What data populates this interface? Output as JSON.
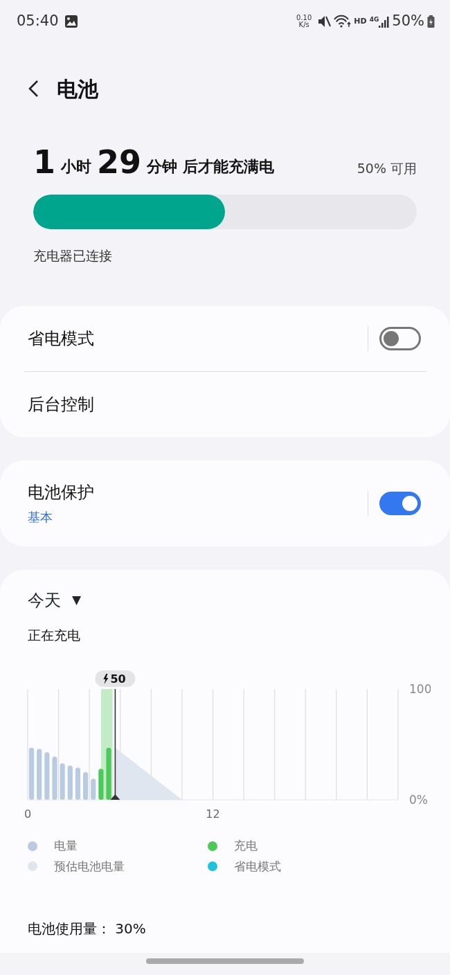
{
  "status_bar": {
    "time": "05:40",
    "net_speed": [
      "0.10",
      "K/s"
    ],
    "network": "HD",
    "cell": "4G",
    "battery": "50%"
  },
  "header": {
    "title": "电池"
  },
  "charge": {
    "parts": [
      {
        "kind": "number",
        "text": "1"
      },
      {
        "kind": "unit",
        "text": "小时"
      },
      {
        "kind": "number",
        "text": "29"
      },
      {
        "kind": "unit",
        "text": "分钟"
      },
      {
        "kind": "unit",
        "text": "后才能充满电"
      }
    ],
    "available": "50% 可用",
    "level": 0.5,
    "status": "充电器已连接"
  },
  "cards": [
    {
      "rows": [
        {
          "label": "省电模式",
          "kind": "toggle",
          "on": false
        },
        {
          "label": "后台控制",
          "kind": "link"
        }
      ]
    },
    {
      "rows": [
        {
          "label": "电池保护",
          "sublabel": "基本",
          "kind": "toggle",
          "on": true
        }
      ]
    }
  ],
  "usage": {
    "period": "今天",
    "caret": "▼",
    "state": "正在充电",
    "chart_data": {
      "type": "bar",
      "x": [
        0,
        0.5,
        1,
        1.5,
        2,
        2.5,
        3,
        3.5,
        4,
        4.5,
        5
      ],
      "series": [
        {
          "name": "电量",
          "color": "#b9cbe0",
          "values": [
            47,
            46,
            43,
            39,
            33,
            31,
            29,
            25,
            19,
            null,
            null
          ]
        },
        {
          "name": "充电",
          "color": "#4cc95a",
          "values": [
            null,
            null,
            null,
            null,
            null,
            null,
            null,
            null,
            null,
            28,
            47
          ]
        }
      ],
      "xlim": [
        0,
        24
      ],
      "ylim": [
        0,
        100
      ],
      "xticks": [
        0,
        12
      ],
      "yticks": [
        {
          "value": 0,
          "label": "0%"
        },
        {
          "value": 100,
          "label": "100"
        }
      ],
      "orientation": "vertical",
      "bands": [
        {
          "axis": "x",
          "from": 4.75,
          "to": 5.5,
          "color": "#c2ecc6"
        }
      ],
      "ref_lines": [
        {
          "axis": "x",
          "value": 5.67,
          "color": "#333333"
        }
      ]
    },
    "now_label": "50",
    "extra_legend": [
      {
        "label": "预估电池电量",
        "color": "#dfe6ef"
      },
      {
        "label": "省电模式",
        "color": "#1fc1de"
      }
    ],
    "total": "电池使用量： 30%"
  }
}
